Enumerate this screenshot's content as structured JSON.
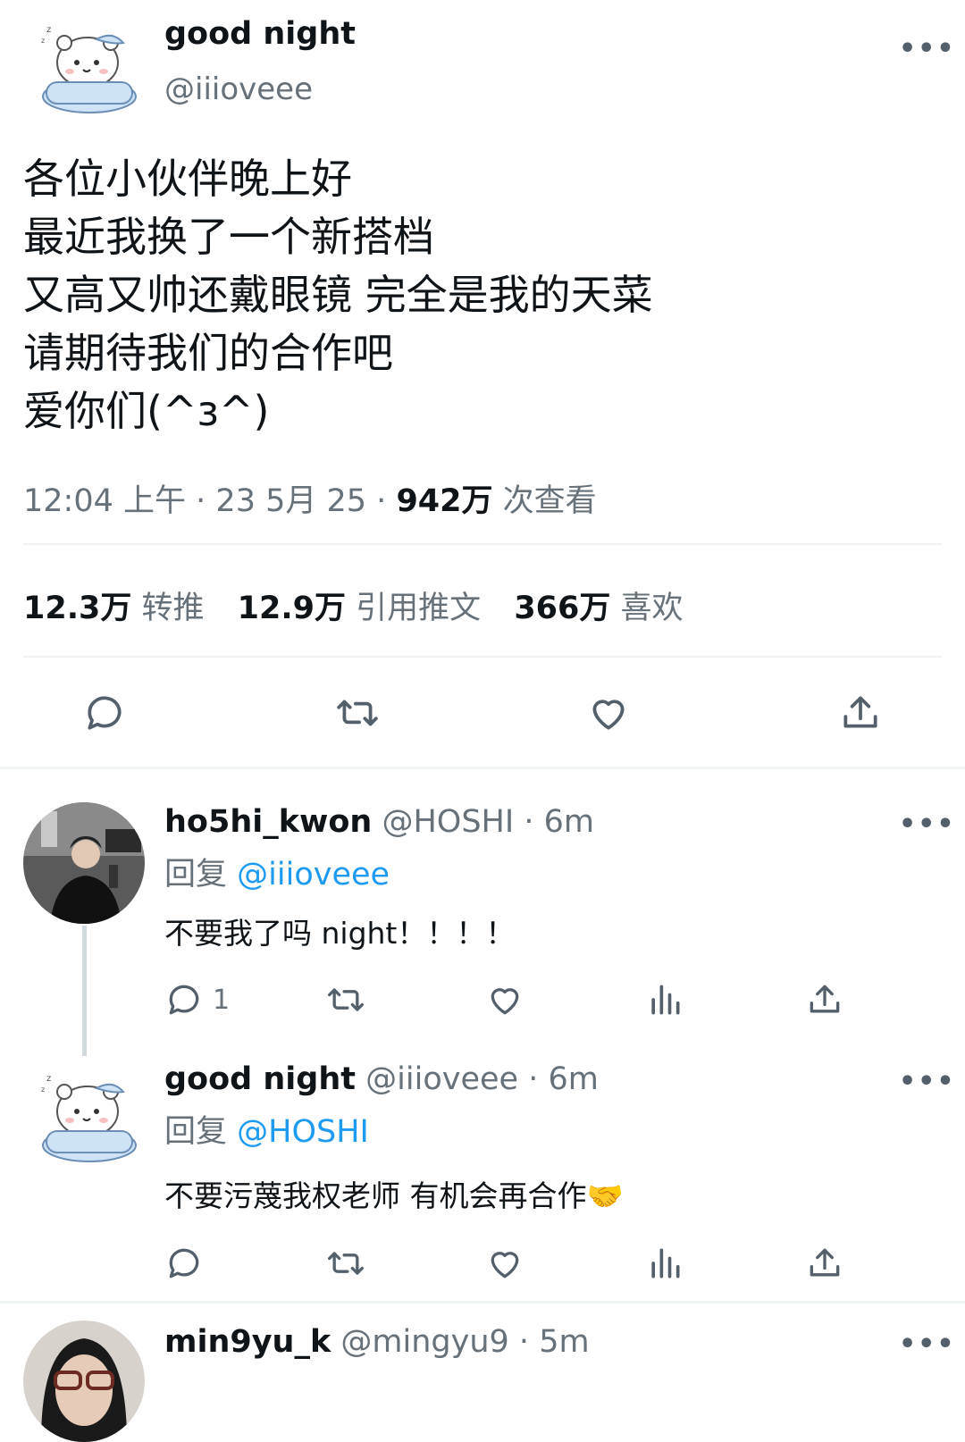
{
  "tweet": {
    "author_name": "good night",
    "author_handle": "@iiioveee",
    "text_lines": [
      "各位小伙伴晚上好",
      "最近我换了一个新搭档",
      "又高又帅还戴眼镜 完全是我的天菜",
      "请期待我们的合作吧",
      "爱你们(^з^)"
    ],
    "time": "12:04 上午",
    "date": "23 5月 25",
    "views_count": "942万",
    "views_label": "次查看",
    "retweets_count": "12.3万",
    "retweets_label": "转推",
    "quotes_count": "12.9万",
    "quotes_label": "引用推文",
    "likes_count": "366万",
    "likes_label": "喜欢"
  },
  "replies": [
    {
      "name": "ho5hi_kwon",
      "handle": "@HOSHI",
      "time": "6m",
      "reply_prefix": "回复",
      "reply_to": "@iiioveee",
      "text": "不要我了吗 night！！！！",
      "reply_count": "1"
    },
    {
      "name": "good night",
      "handle": "@iiioveee",
      "time": "6m",
      "reply_prefix": "回复",
      "reply_to": "@HOSHI",
      "text": "不要污蔑我权老师 有机会再合作🤝"
    },
    {
      "name": "min9yu_k",
      "handle": "@mingyu9",
      "time": "5m"
    }
  ],
  "more_glyph": "•••",
  "dot_sep": "·",
  "colors": {
    "link": "#1d9bf0",
    "muted": "#66717a",
    "divider": "#eff3f4"
  }
}
